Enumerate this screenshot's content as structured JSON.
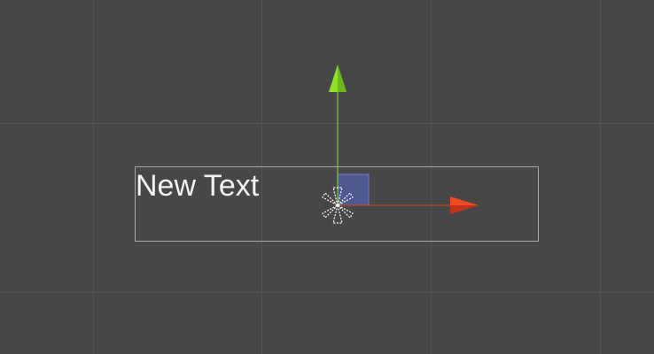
{
  "scene": {
    "text_object": {
      "text": "New Text"
    },
    "gizmo": {
      "tool": "move",
      "x_axis_color": "#e63c1f",
      "y_axis_color": "#8fdf2c",
      "plane_handle_color": "#4f5fa8",
      "pivot_icon": "pivot-icon"
    },
    "grid": {
      "visible": true,
      "background_color": "#474747",
      "line_color": "#545454"
    }
  }
}
